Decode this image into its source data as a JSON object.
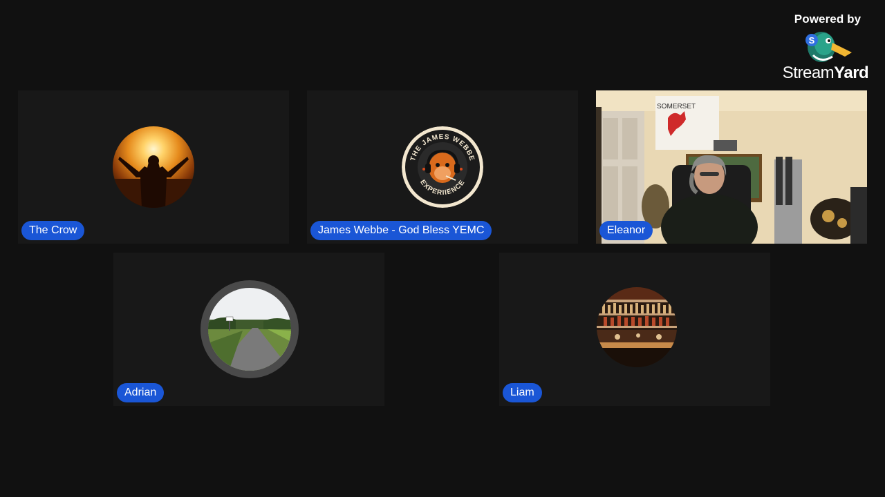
{
  "branding": {
    "powered_by": "Powered by",
    "logo_icon": "streamyard-duck-icon",
    "wordmark_light": "Stream",
    "wordmark_bold": "Yard"
  },
  "participants": [
    {
      "name": "The Crow",
      "avatar": "sunset-silhouette-avatar",
      "video": false
    },
    {
      "name": "James Webbe - God Bless YEMC",
      "avatar": "the-james-webbe-experience-logo",
      "logo_text": "THE JAMES WEBBE EXPERIIENCE",
      "video": false
    },
    {
      "name": "Eleanor",
      "video": true,
      "background_sign": "SOMERSET"
    },
    {
      "name": "Adrian",
      "avatar": "country-road-avatar",
      "video": false
    },
    {
      "name": "Liam",
      "avatar": "bar-shelves-avatar",
      "video": false
    }
  ],
  "colors": {
    "background": "#111111",
    "tile": "#181818",
    "nametag": "#1a56d6"
  }
}
